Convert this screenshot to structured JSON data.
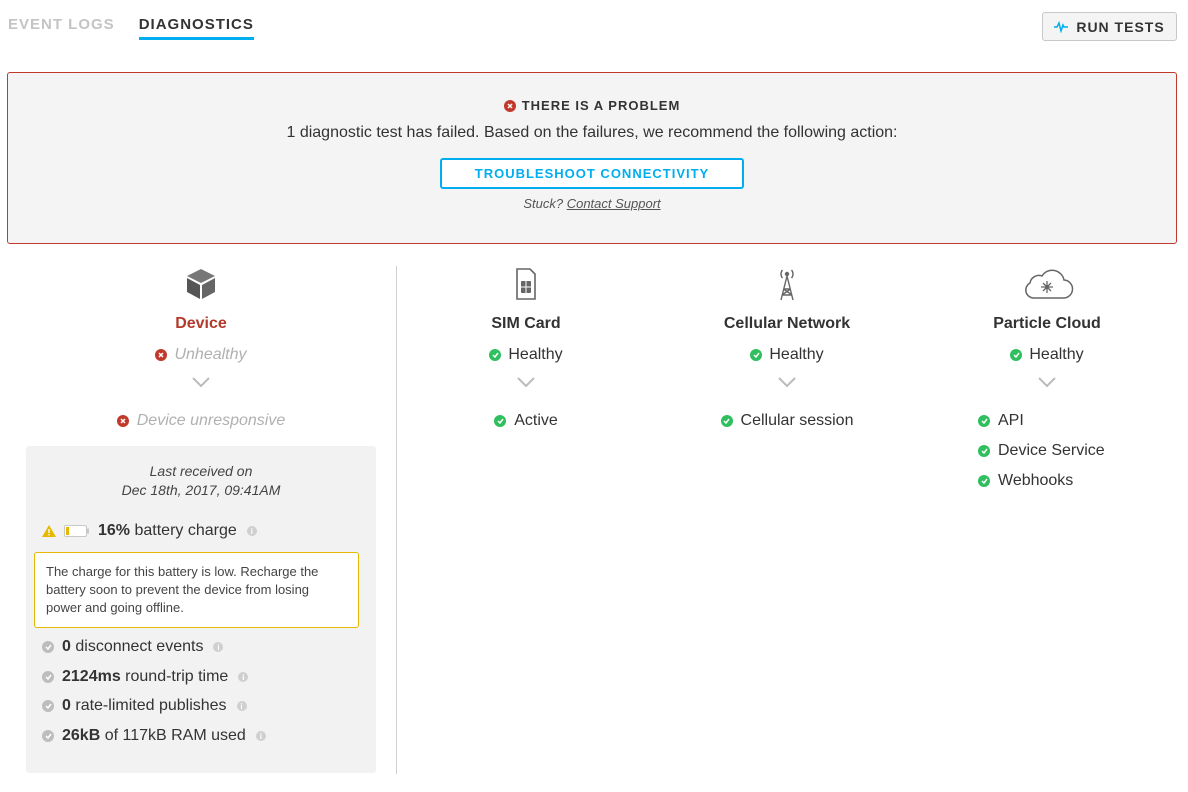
{
  "tabs": [
    {
      "label": "EVENT LOGS",
      "active": false
    },
    {
      "label": "DIAGNOSTICS",
      "active": true
    }
  ],
  "toolbar": {
    "run_tests_label": "RUN TESTS",
    "run_tests_icon": "pulse-icon"
  },
  "banner": {
    "title": "THERE IS A PROBLEM",
    "message": "1 diagnostic test has failed. Based on the failures, we recommend the following action:",
    "action_label": "TROUBLESHOOT CONNECTIVITY",
    "stuck_label": "Stuck?",
    "support_link": "Contact Support",
    "border_color": "#c0392b"
  },
  "columns": {
    "device": {
      "title": "Device",
      "icon": "cube-icon",
      "status": "Unhealthy",
      "items": [
        {
          "label": "Device unresponsive",
          "state": "error"
        }
      ],
      "details": {
        "last_received_label": "Last received on",
        "last_received_date": "Dec 18th, 2017, 09:41AM",
        "battery_value": "16%",
        "battery_text": "battery charge",
        "battery_level": 0.16,
        "battery_warning": "The charge for this battery is low. Recharge the battery soon to prevent the device from losing power and going offline.",
        "stats": [
          {
            "value": "0",
            "text": "disconnect events"
          },
          {
            "value": "2124ms",
            "text": "round-trip time"
          },
          {
            "value": "0",
            "text": "rate-limited publishes"
          },
          {
            "value": "26kB",
            "text": "of 117kB RAM used"
          }
        ]
      }
    },
    "sim": {
      "title": "SIM Card",
      "icon": "sim-card-icon",
      "status": "Healthy",
      "items": [
        {
          "label": "Active",
          "state": "ok"
        }
      ]
    },
    "cellular": {
      "title": "Cellular Network",
      "icon": "cell-tower-icon",
      "status": "Healthy",
      "items": [
        {
          "label": "Cellular session",
          "state": "ok"
        }
      ]
    },
    "cloud": {
      "title": "Particle Cloud",
      "icon": "cloud-icon",
      "status": "Healthy",
      "items": [
        {
          "label": "API",
          "state": "ok"
        },
        {
          "label": "Device Service",
          "state": "ok"
        },
        {
          "label": "Webhooks",
          "state": "ok"
        }
      ]
    }
  },
  "colors": {
    "accent": "#00aeef",
    "ok": "#2fbf5f",
    "error": "#c0392b",
    "warning": "#e7b800"
  }
}
